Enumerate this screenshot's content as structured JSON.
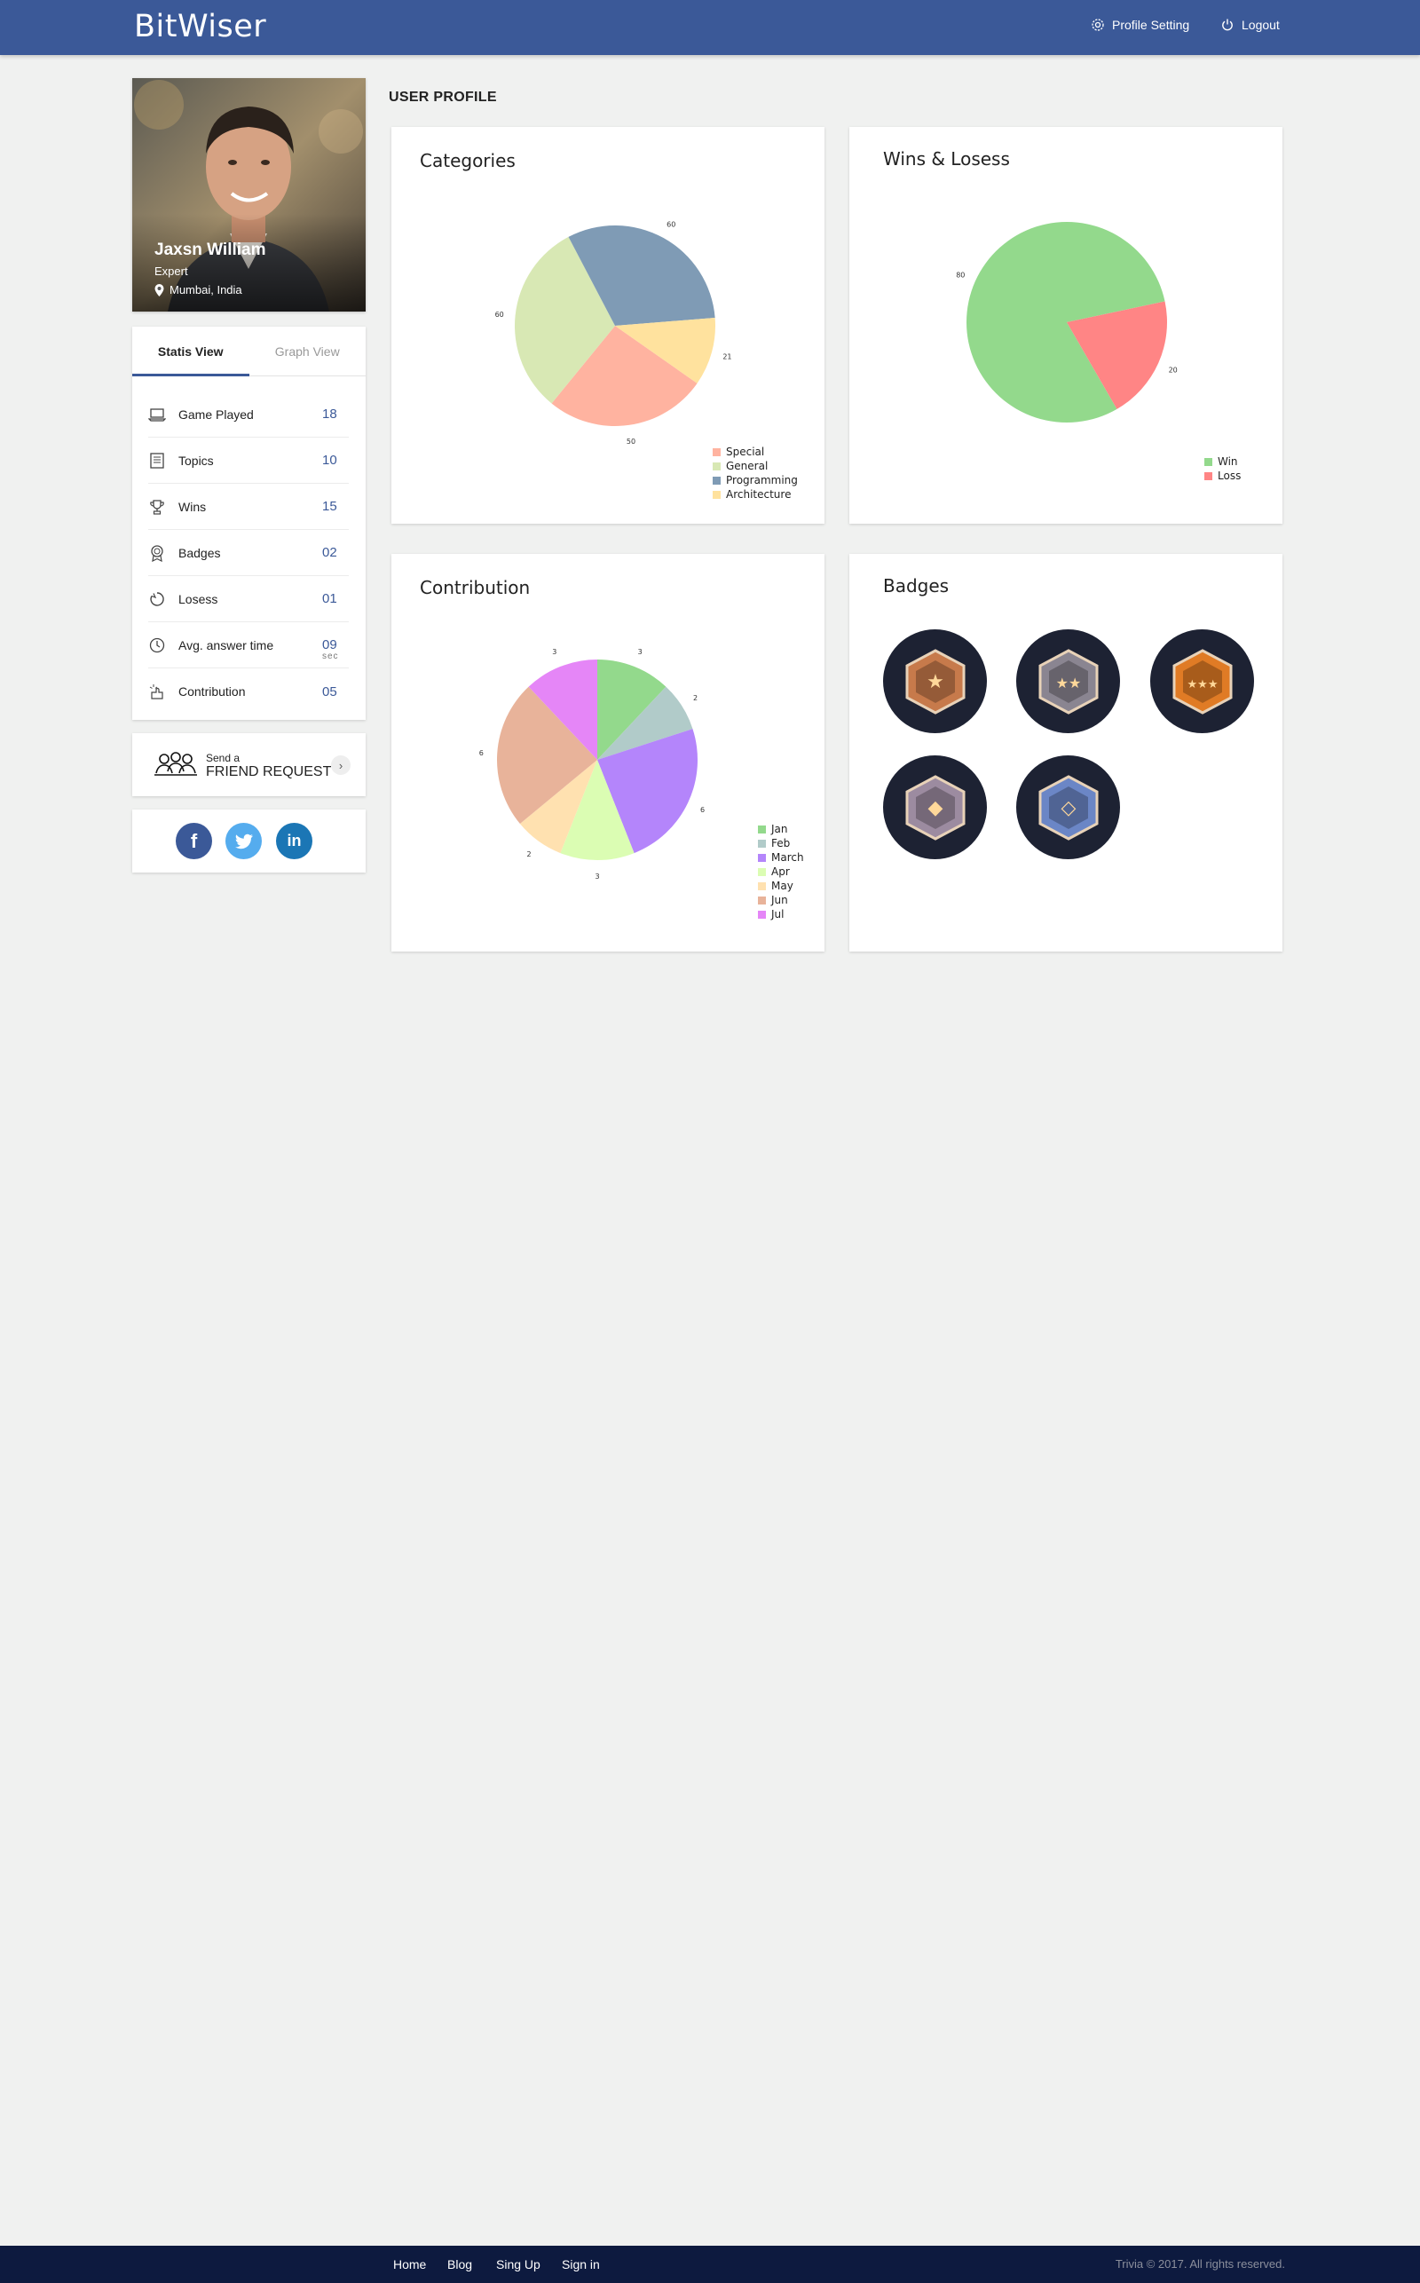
{
  "header": {
    "brand": "BitWiser",
    "profile_setting": "Profile Setting",
    "logout": "Logout"
  },
  "profile": {
    "name": "Jaxsn William",
    "rank": "Expert",
    "location": "Mumbai, India"
  },
  "stats_tabs": [
    "Statis View",
    "Graph View"
  ],
  "stats": [
    {
      "label": "Game Played",
      "value": "18",
      "icon": "laptop-icon"
    },
    {
      "label": "Topics",
      "value": "10",
      "icon": "document-icon"
    },
    {
      "label": "Wins",
      "value": "15",
      "icon": "trophy-icon"
    },
    {
      "label": "Badges",
      "value": "02",
      "icon": "medal-icon"
    },
    {
      "label": "Losess",
      "value": "01",
      "icon": "broken-circle-icon"
    },
    {
      "label": "Avg. answer time",
      "value": "09",
      "sub": "sec",
      "icon": "clock-icon"
    },
    {
      "label": "Contribution",
      "value": "05",
      "icon": "hand-sparkle-icon"
    }
  ],
  "friend_request": {
    "small": "Send a",
    "big": "FRIEND REQUEST"
  },
  "social": [
    {
      "name": "facebook",
      "glyph": "f",
      "color": "#3b5998"
    },
    {
      "name": "twitter",
      "glyph": "t",
      "color": "#55acee"
    },
    {
      "name": "linkedin",
      "glyph": "in",
      "color": "#1b76b5"
    }
  ],
  "section_title": "USER PROFILE",
  "panels": {
    "categories": "Categories",
    "wins": "Wins & Losess",
    "contribution": "Contribution",
    "badges": "Badges"
  },
  "chart_data": [
    {
      "type": "pie",
      "title": "Categories",
      "labels": [
        "Special",
        "General",
        "Programming",
        "Architecture"
      ],
      "values": [
        50,
        60,
        60,
        21
      ],
      "colors": [
        "#ffb3a0",
        "#d8e8b4",
        "#7f9bb5",
        "#ffe29e"
      ],
      "legend": "bottom-right"
    },
    {
      "type": "pie",
      "title": "Wins & Losess",
      "labels": [
        "Win",
        "Loss"
      ],
      "values": [
        80,
        20
      ],
      "colors": [
        "#93d98c",
        "#ff8585"
      ],
      "legend": "bottom-right"
    },
    {
      "type": "pie",
      "title": "Contribution",
      "labels": [
        "Jan",
        "Feb",
        "March",
        "Apr",
        "May",
        "Jun",
        "Jul"
      ],
      "values": [
        3,
        2,
        6,
        3,
        2,
        6,
        3
      ],
      "colors": [
        "#93d98c",
        "#b1cbc9",
        "#b485fb",
        "#dbfdb3",
        "#ffe1b0",
        "#e8b39a",
        "#e586f7"
      ],
      "legend": "bottom-right"
    }
  ],
  "badges": [
    {
      "name": "bronze-star-badge",
      "tone": "#c77a4b",
      "mark": "★"
    },
    {
      "name": "silver-two-star-badge",
      "tone": "#8a8591",
      "mark": "★★"
    },
    {
      "name": "gold-three-star-badge",
      "tone": "#e07b25",
      "mark": "★★★"
    },
    {
      "name": "winged-bolt-badge",
      "tone": "#9c8ba0",
      "mark": "◆"
    },
    {
      "name": "diamond-badge",
      "tone": "#6b86c6",
      "mark": "◇"
    }
  ],
  "footer": {
    "links": [
      "Home",
      "Blog",
      "Sing Up",
      "Sign in"
    ],
    "copyright": "Trivia © 2017. All rights reserved."
  }
}
